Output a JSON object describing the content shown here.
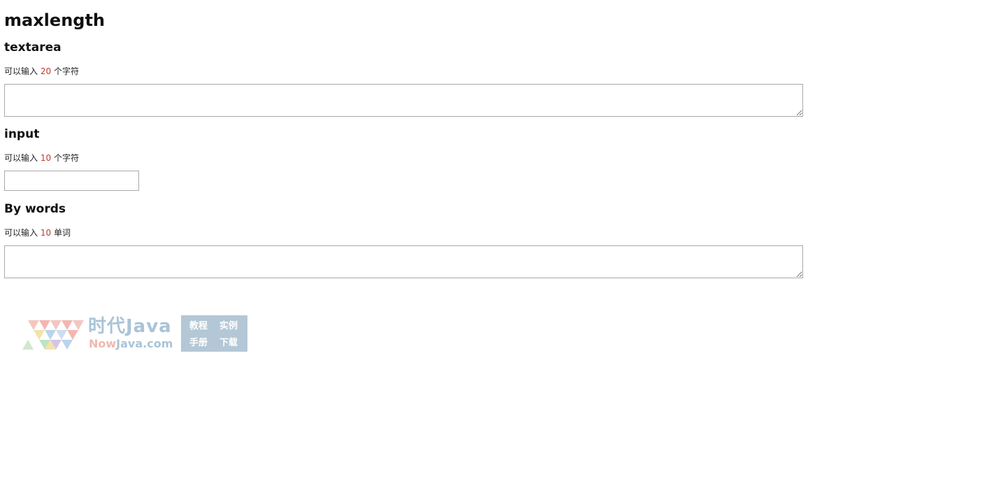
{
  "title": "maxlength",
  "sections": [
    {
      "heading": "textarea",
      "hint_prefix": "可以输入",
      "hint_value": "20",
      "hint_suffix": "个字符",
      "field_value": ""
    },
    {
      "heading": "input",
      "hint_prefix": "可以输入",
      "hint_value": "10",
      "hint_suffix": "个字符",
      "field_value": ""
    },
    {
      "heading": "By words",
      "hint_prefix": "可以输入",
      "hint_value": "10",
      "hint_suffix": "单词",
      "field_value": ""
    }
  ],
  "watermark": {
    "brand": "时代Java",
    "domain_now": "Now",
    "domain_rest": "Java.com",
    "box_items": [
      "教程",
      "实例",
      "手册",
      "下载"
    ],
    "colors": {
      "text": "#a9c4d8",
      "now": "#f0b8b0",
      "box": "#b3c7d6"
    }
  },
  "colors": {
    "hint_number": "#c0392b",
    "field_border": "#a9a9a9"
  }
}
